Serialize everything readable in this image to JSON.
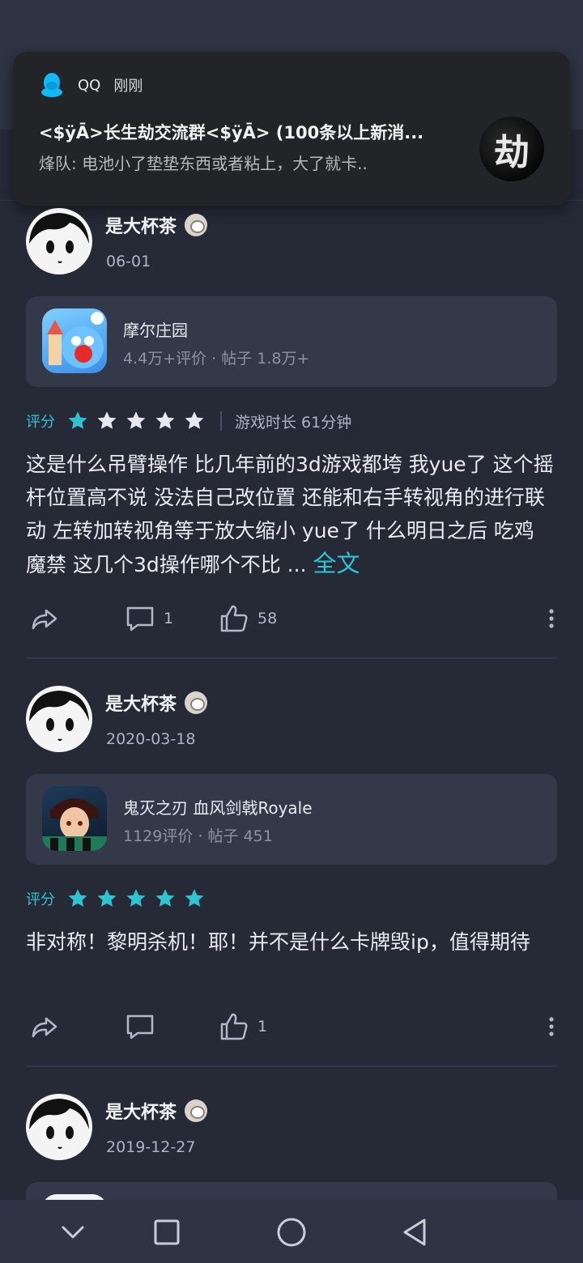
{
  "notification": {
    "app_name": "QQ",
    "time": "刚刚",
    "title": "<$ÿĀ>长生劫交流群<$ÿĀ> (100条以上新消...",
    "body": "烽队: 电池小了垫垫东西或者粘上，大了就卡..",
    "avatar_char": "劫"
  },
  "posts": [
    {
      "username": "是大杯茶",
      "date": "06-01",
      "game_name": "摩尔庄园",
      "game_meta": "4.4万+评价 · 帖子 1.8万+",
      "rating_label": "评分",
      "stars": 1,
      "playtime": "游戏时长 61分钟",
      "content": "这是什么吊臂操作 比几年前的3d游戏都垮 我yue了 这个摇杆位置高不说 没法自己改位置 还能和右手转视角的进行联动 左转加转视角等于放大缩小 yue了 什么明日之后 吃鸡 魔禁 这几个3d操作哪个不比 ...",
      "fulltext_label": "全文",
      "comments": "1",
      "likes": "58"
    },
    {
      "username": "是大杯茶",
      "date": "2020-03-18",
      "game_name": "鬼灭之刃 血风剑戟Royale",
      "game_meta": "1129评价 · 帖子 451",
      "rating_label": "评分",
      "stars": 5,
      "content": "非对称！黎明杀机！耶！并不是什么卡牌毁ip，值得期待",
      "comments": "",
      "likes": "1"
    },
    {
      "username": "是大杯茶",
      "date": "2019-12-27"
    }
  ],
  "colors": {
    "accent": "#2ec4d4",
    "background": "#262a37",
    "card": "#343949",
    "star_inactive": "#e6e8ee"
  }
}
